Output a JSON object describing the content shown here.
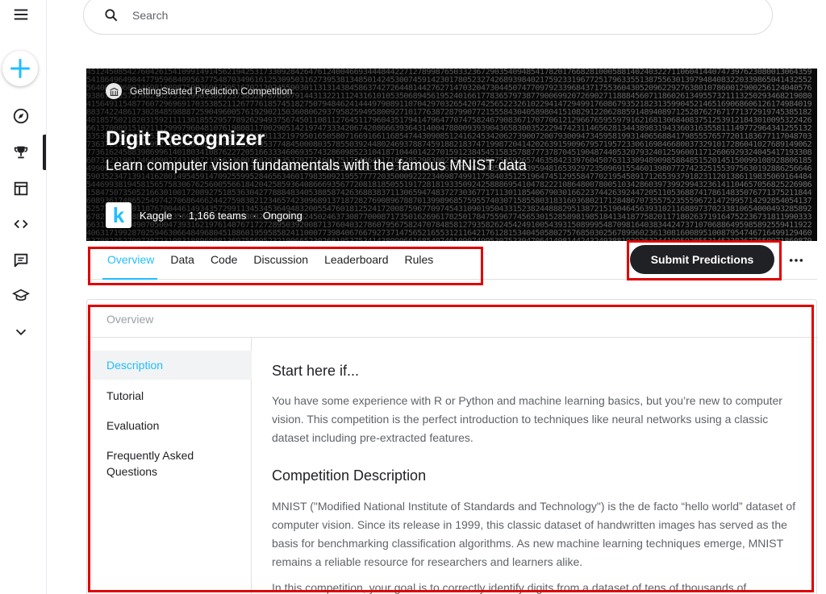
{
  "search": {
    "placeholder": "Search"
  },
  "rail": {
    "items": [
      "menu-icon",
      "create-icon",
      "compass-icon",
      "trophy-icon",
      "table-icon",
      "code-icon",
      "comment-icon",
      "school-icon",
      "chevron-down-icon"
    ]
  },
  "hero": {
    "type_label": "GettingStarted Prediction Competition",
    "title": "Digit Recognizer",
    "subtitle": "Learn computer vision fundamentals with the famous MNIST data",
    "host": "Kaggle",
    "teams": "1,166 teams",
    "status": "Ongoing",
    "logo_letter": "k"
  },
  "tabs": [
    "Overview",
    "Data",
    "Code",
    "Discussion",
    "Leaderboard",
    "Rules"
  ],
  "active_tab": "Overview",
  "actions": {
    "submit_label": "Submit Predictions",
    "more_label": "•••"
  },
  "overview": {
    "heading": "Overview",
    "side_items": [
      "Description",
      "Tutorial",
      "Evaluation",
      "Frequently Asked Questions"
    ],
    "sections": [
      {
        "heading": "Start here if...",
        "body": "You have some experience with R or Python and machine learning basics, but you’re new to computer vision. This competition is the perfect introduction to techniques like neural networks using a classic dataset including pre-extracted features."
      },
      {
        "heading": "Competition Description",
        "body": "MNIST (\"Modified National Institute of Standards and Technology\") is the de facto “hello world” dataset of computer vision. Since its release in 1999, this classic dataset of handwritten images has served as the basis for benchmarking classification algorithms. As new machine learning techniques emerge, MNIST remains a reliable resource for researchers and learners alike."
      }
    ],
    "trailing_text": "In this competition, your goal is to correctly identify digits from a dataset of tens of thousands of"
  },
  "colors": {
    "accent": "#20beff",
    "dark_button": "#202124",
    "annotation": "#e00000"
  }
}
